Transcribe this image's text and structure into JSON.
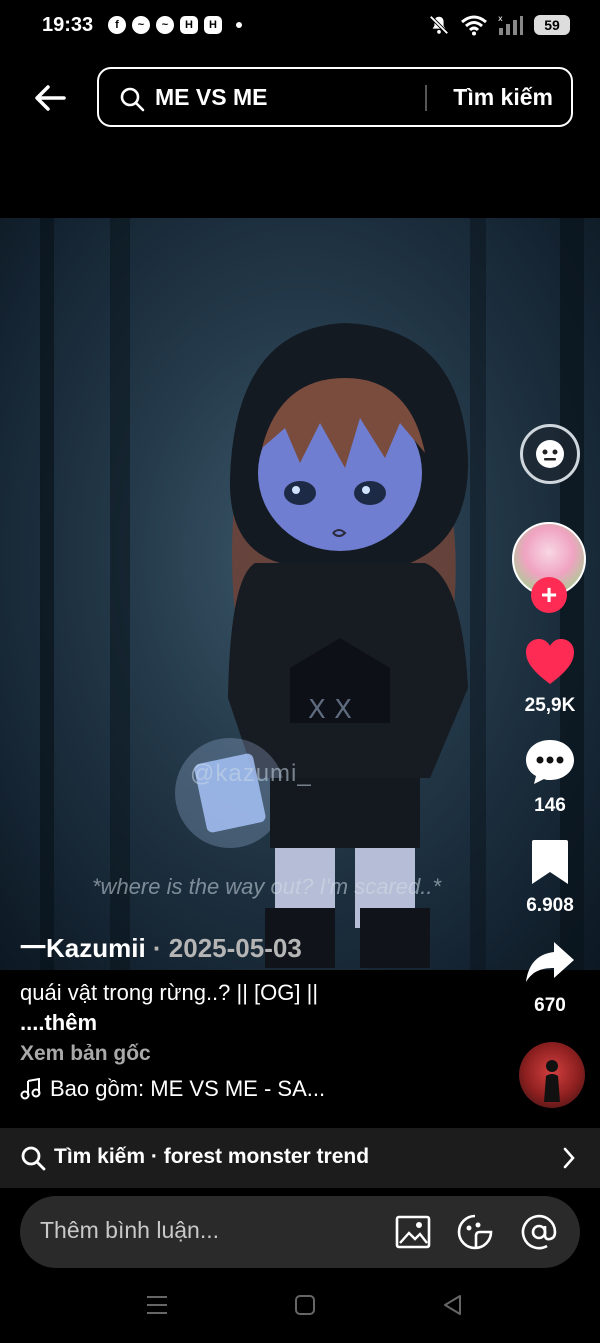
{
  "status_bar": {
    "time": "19:33",
    "battery": "59",
    "notification_icons": [
      "facebook-icon",
      "messenger-icon",
      "messenger-icon",
      "app-icon",
      "app-icon"
    ]
  },
  "search": {
    "query": "ME VS ME",
    "button_label": "Tìm kiếm"
  },
  "video": {
    "watermark": "@kazumi_",
    "subtitle": "*where is the way out? I'm scared..*"
  },
  "actions": {
    "likes": "25,9K",
    "comments": "146",
    "saves": "6.908",
    "shares": "670",
    "like_color": "#fe2c55"
  },
  "post": {
    "author": "一Kazumii",
    "date": "· 2025-05-03",
    "description": "quái vật trong rừng..? || [OG] ||",
    "more": "....thêm",
    "see_original": "Xem bản gốc",
    "music": "Bao gồm: ME VS ME - SA..."
  },
  "suggestion": {
    "text": "Tìm kiếm · forest monster trend"
  },
  "comment_bar": {
    "placeholder": "Thêm bình luận..."
  }
}
